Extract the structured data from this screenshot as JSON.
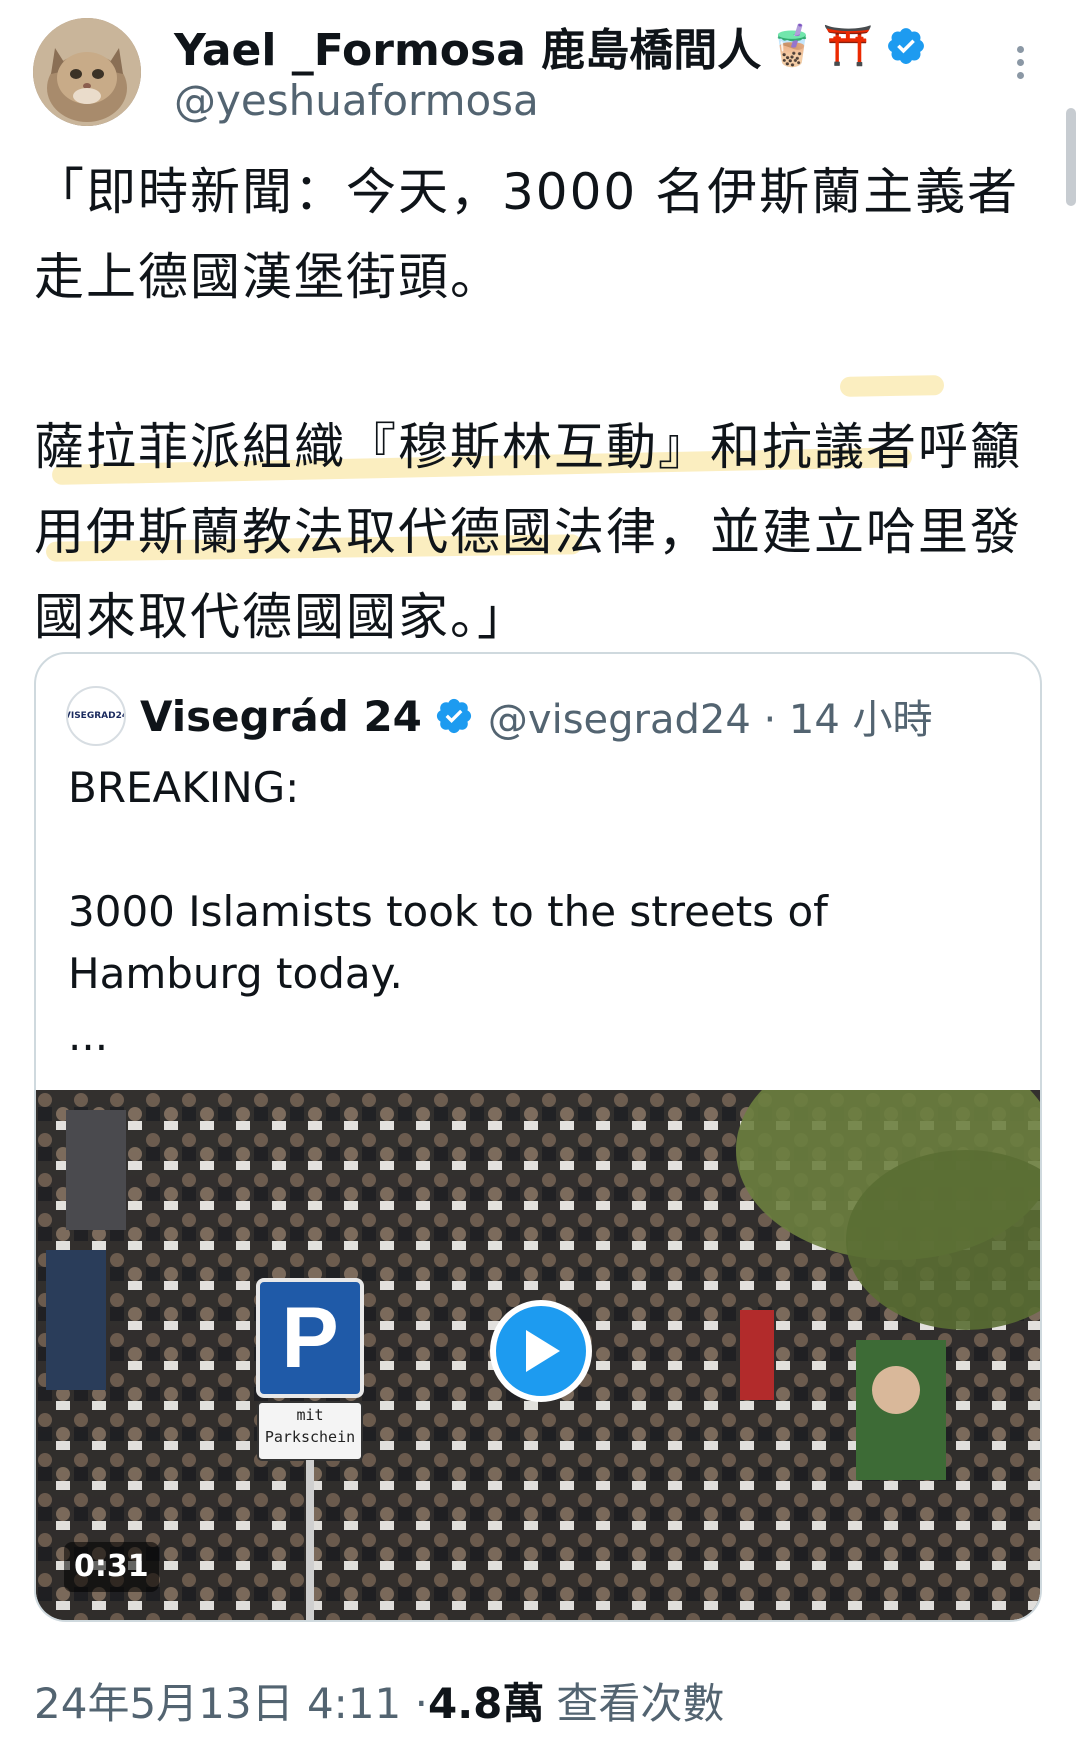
{
  "author": {
    "display_name": "Yael _Formosa 鹿島橋間人",
    "emojis": [
      "🧋",
      "⛩️"
    ],
    "handle": "@yeshuaformosa",
    "verified_icon": "verified-badge-icon"
  },
  "tweet": {
    "paragraph_1": "「即時新聞：今天，3000 名伊斯蘭主義者走上德國漢堡街頭。",
    "paragraph_2": "薩拉菲派組織『穆斯林互動』和抗議者呼籲用伊斯蘭教法取代德國法律，並建立哈里發國來取代德國國家。」"
  },
  "quote": {
    "avatar_text": "VISEGRAD24",
    "name": "Visegrád 24",
    "handle_time": "@visegrad24 · 14 小時",
    "line_1": "BREAKING:",
    "line_2": "3000 Islamists took to the streets of Hamburg today.",
    "ellipsis": "...",
    "video_duration": "0:31",
    "parking_sign": "P",
    "parking_note_1": "mit",
    "parking_note_2": "Parkschein"
  },
  "meta": {
    "date_time": "24年5月13日 4:11 · ",
    "views_count": "4.8萬",
    "views_label": "查看次數"
  },
  "colors": {
    "accent": "#1d9bf0",
    "highlight": "#fbeec0",
    "secondary_text": "#536471"
  }
}
